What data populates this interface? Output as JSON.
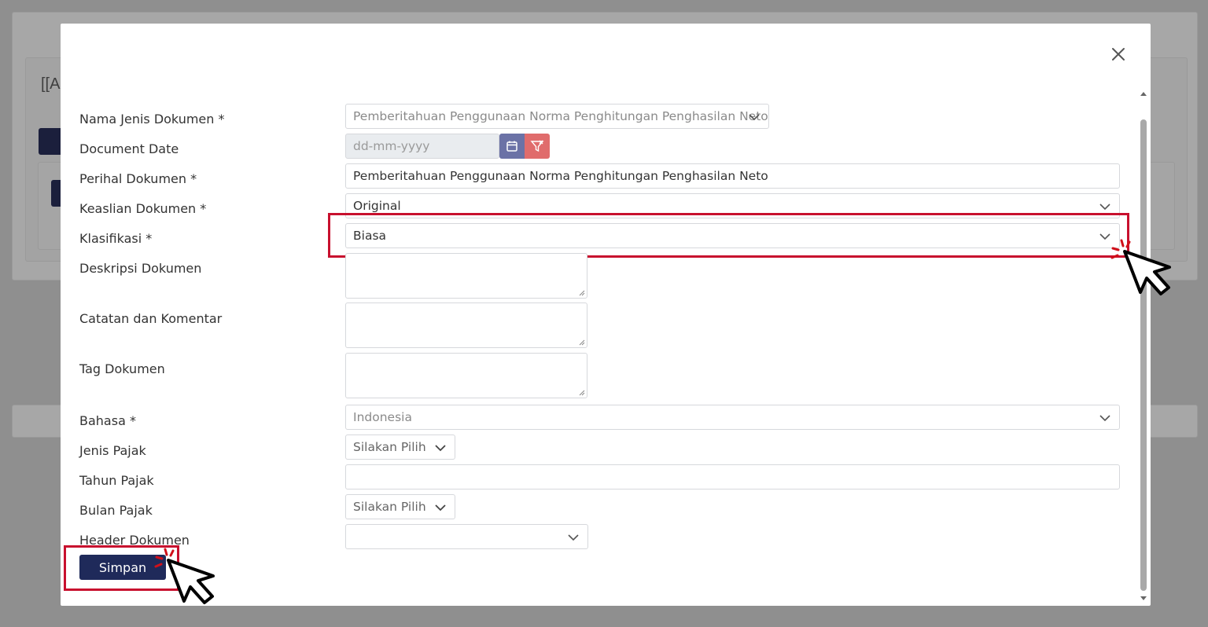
{
  "background": {
    "partial_text": "[[A"
  },
  "modal": {
    "fields": {
      "nama_jenis_dokumen": {
        "label": "Nama Jenis Dokumen *",
        "value": "Pemberitahuan Penggunaan Norma Penghitungan Penghasilan Neto"
      },
      "document_date": {
        "label": "Document Date",
        "placeholder": "dd-mm-yyyy"
      },
      "perihal_dokumen": {
        "label": "Perihal Dokumen *",
        "value": "Pemberitahuan Penggunaan Norma Penghitungan Penghasilan Neto"
      },
      "keaslian_dokumen": {
        "label": "Keaslian Dokumen *",
        "value": "Original"
      },
      "klasifikasi": {
        "label": "Klasifikasi *",
        "value": "Biasa"
      },
      "deskripsi_dokumen": {
        "label": "Deskripsi Dokumen"
      },
      "catatan_komentar": {
        "label": "Catatan dan Komentar"
      },
      "tag_dokumen": {
        "label": "Tag Dokumen"
      },
      "bahasa": {
        "label": "Bahasa *",
        "value": "Indonesia"
      },
      "jenis_pajak": {
        "label": "Jenis Pajak",
        "value": "Silakan Pilih"
      },
      "tahun_pajak": {
        "label": "Tahun Pajak",
        "value": ""
      },
      "bulan_pajak": {
        "label": "Bulan Pajak",
        "value": "Silakan Pilih"
      },
      "header_dokumen": {
        "label": "Header Dokumen",
        "value": ""
      }
    },
    "save_label": "Simpan"
  },
  "colors": {
    "primary": "#1f2a5a",
    "calendar_button": "#6b72a6",
    "clear_button": "#e06c6c",
    "highlight": "#c8102e"
  }
}
